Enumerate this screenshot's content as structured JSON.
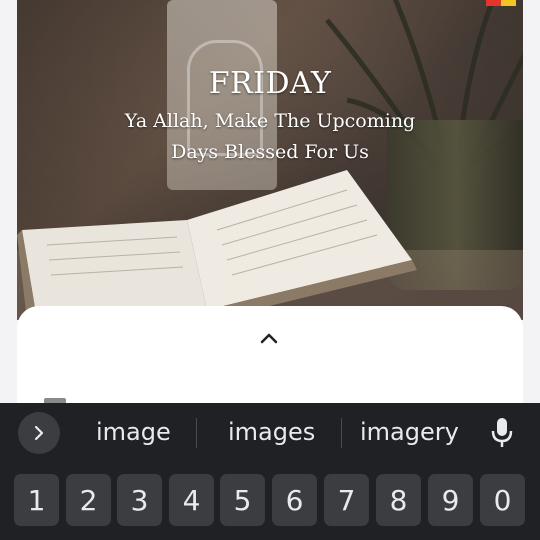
{
  "card": {
    "title": "FRIDAY",
    "line1": "Ya Allah, Make The Upcoming",
    "line2": "Days Blessed For Us"
  },
  "keyboard": {
    "suggestions": [
      "image",
      "images",
      "imagery"
    ],
    "number_row": [
      "1",
      "2",
      "3",
      "4",
      "5",
      "6",
      "7",
      "8",
      "9",
      "0"
    ]
  },
  "icons": {
    "expand": "chevron-right-icon",
    "sheet_toggle": "chevron-up-icon",
    "voice": "mic-icon"
  },
  "colors": {
    "keyboard_bg": "#202124",
    "key_bg": "#3c3d40",
    "key_text": "#e8eaed",
    "sheet_bg": "#ffffff"
  }
}
